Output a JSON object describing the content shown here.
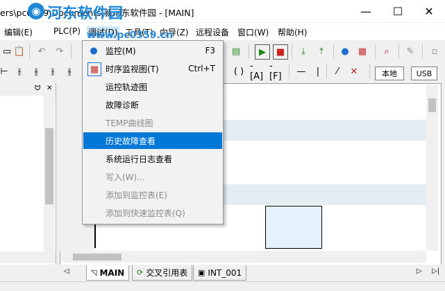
{
  "window": {
    "title": "ers\\pc0359\\Documents\\新河东软件园 - [MAIN]",
    "minimize": "—",
    "maximize": "☐",
    "close": "✕"
  },
  "watermark": {
    "name": "河东软件园",
    "url": "www.pc0359.cn"
  },
  "menubar": {
    "items": [
      "编辑(E)",
      "PLC(P)",
      "调试(D)",
      "工具(T)",
      "向导(Z)",
      "远程设备",
      "窗口(W)",
      "帮助(H)"
    ]
  },
  "toolbar2": {
    "local_button": "本地",
    "usb_button": "USB"
  },
  "left_panel": {
    "pin": "ᗢ",
    "close": "✕"
  },
  "dropdown": {
    "items": [
      {
        "label": "监控(M)",
        "shortcut": "F3",
        "icon": "monitor-icon",
        "disabled": false,
        "highlighted": false
      },
      {
        "label": "时序监视图(T)",
        "shortcut": "Ctrl+T",
        "icon": "timing-chart-icon",
        "disabled": false,
        "highlighted": false
      },
      {
        "label": "运控轨迹图",
        "shortcut": "",
        "icon": "",
        "disabled": false,
        "highlighted": false
      },
      {
        "label": "故障诊断",
        "shortcut": "",
        "icon": "",
        "disabled": false,
        "highlighted": false
      },
      {
        "label": "TEMP曲线图",
        "shortcut": "",
        "icon": "",
        "disabled": true,
        "highlighted": false
      },
      {
        "label": "历史故障查看",
        "shortcut": "",
        "icon": "",
        "disabled": false,
        "highlighted": true
      },
      {
        "label": "系统运行日志查看",
        "shortcut": "",
        "icon": "",
        "disabled": false,
        "highlighted": false
      },
      {
        "label": "写入(W)...",
        "shortcut": "",
        "icon": "",
        "disabled": true,
        "highlighted": false
      },
      {
        "label": "添加到监控表(E)",
        "shortcut": "",
        "icon": "",
        "disabled": true,
        "highlighted": false
      },
      {
        "label": "添加到快速监控表(Q)",
        "shortcut": "",
        "icon": "",
        "disabled": true,
        "highlighted": false
      }
    ]
  },
  "tabs": [
    {
      "label": "MAIN",
      "icon": "ladder-icon",
      "active": true
    },
    {
      "label": "交叉引用表",
      "icon": "cross-reference-icon",
      "active": false
    },
    {
      "label": "INT_001",
      "icon": "interrupt-icon",
      "active": false
    }
  ],
  "colors": {
    "highlight": "#0078d7",
    "watermark": "#1e88d6",
    "band": "#e4edf2"
  }
}
